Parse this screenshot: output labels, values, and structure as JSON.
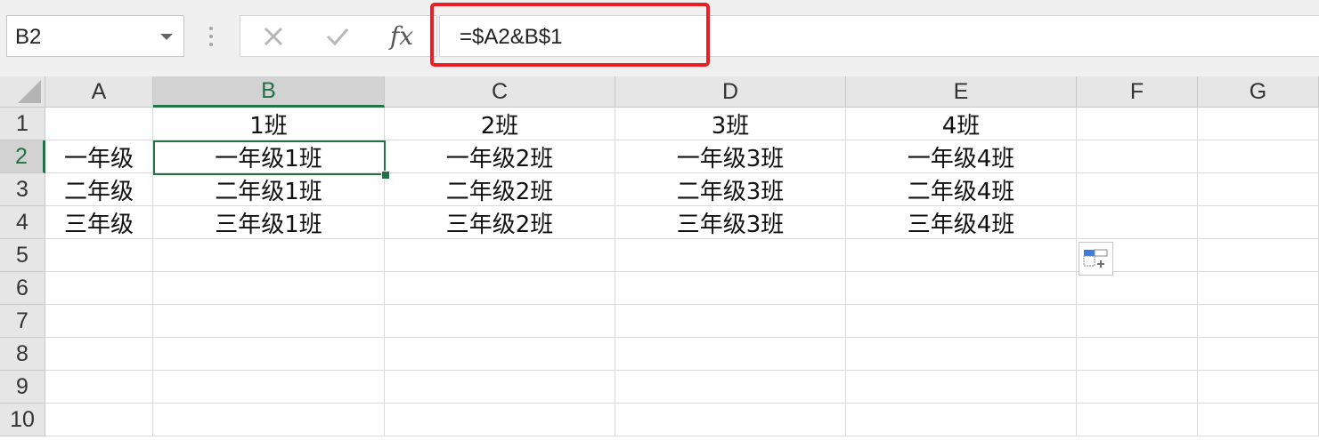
{
  "name_box": {
    "value": "B2"
  },
  "formula_bar": {
    "cancel_icon": "close-icon",
    "enter_icon": "check-icon",
    "fx_label": "fx",
    "formula": "=$A2&B$1"
  },
  "columns": [
    "A",
    "B",
    "C",
    "D",
    "E",
    "F",
    "G"
  ],
  "rows": [
    "1",
    "2",
    "3",
    "4",
    "5",
    "6",
    "7",
    "8",
    "9",
    "10"
  ],
  "selected_cell": "B2",
  "cells": [
    [
      "",
      "1班",
      "2班",
      "3班",
      "4班",
      "",
      ""
    ],
    [
      "一年级",
      "一年级1班",
      "一年级2班",
      "一年级3班",
      "一年级4班",
      "",
      ""
    ],
    [
      "二年级",
      "二年级1班",
      "二年级2班",
      "二年级3班",
      "二年级4班",
      "",
      ""
    ],
    [
      "三年级",
      "三年级1班",
      "三年级2班",
      "三年级3班",
      "三年级4班",
      "",
      ""
    ],
    [
      "",
      "",
      "",
      "",
      "",
      "",
      ""
    ],
    [
      "",
      "",
      "",
      "",
      "",
      "",
      ""
    ],
    [
      "",
      "",
      "",
      "",
      "",
      "",
      ""
    ],
    [
      "",
      "",
      "",
      "",
      "",
      "",
      ""
    ],
    [
      "",
      "",
      "",
      "",
      "",
      "",
      ""
    ],
    [
      "",
      "",
      "",
      "",
      "",
      "",
      ""
    ]
  ],
  "colors": {
    "accent": "#217346",
    "highlight": "#ee1c23"
  }
}
